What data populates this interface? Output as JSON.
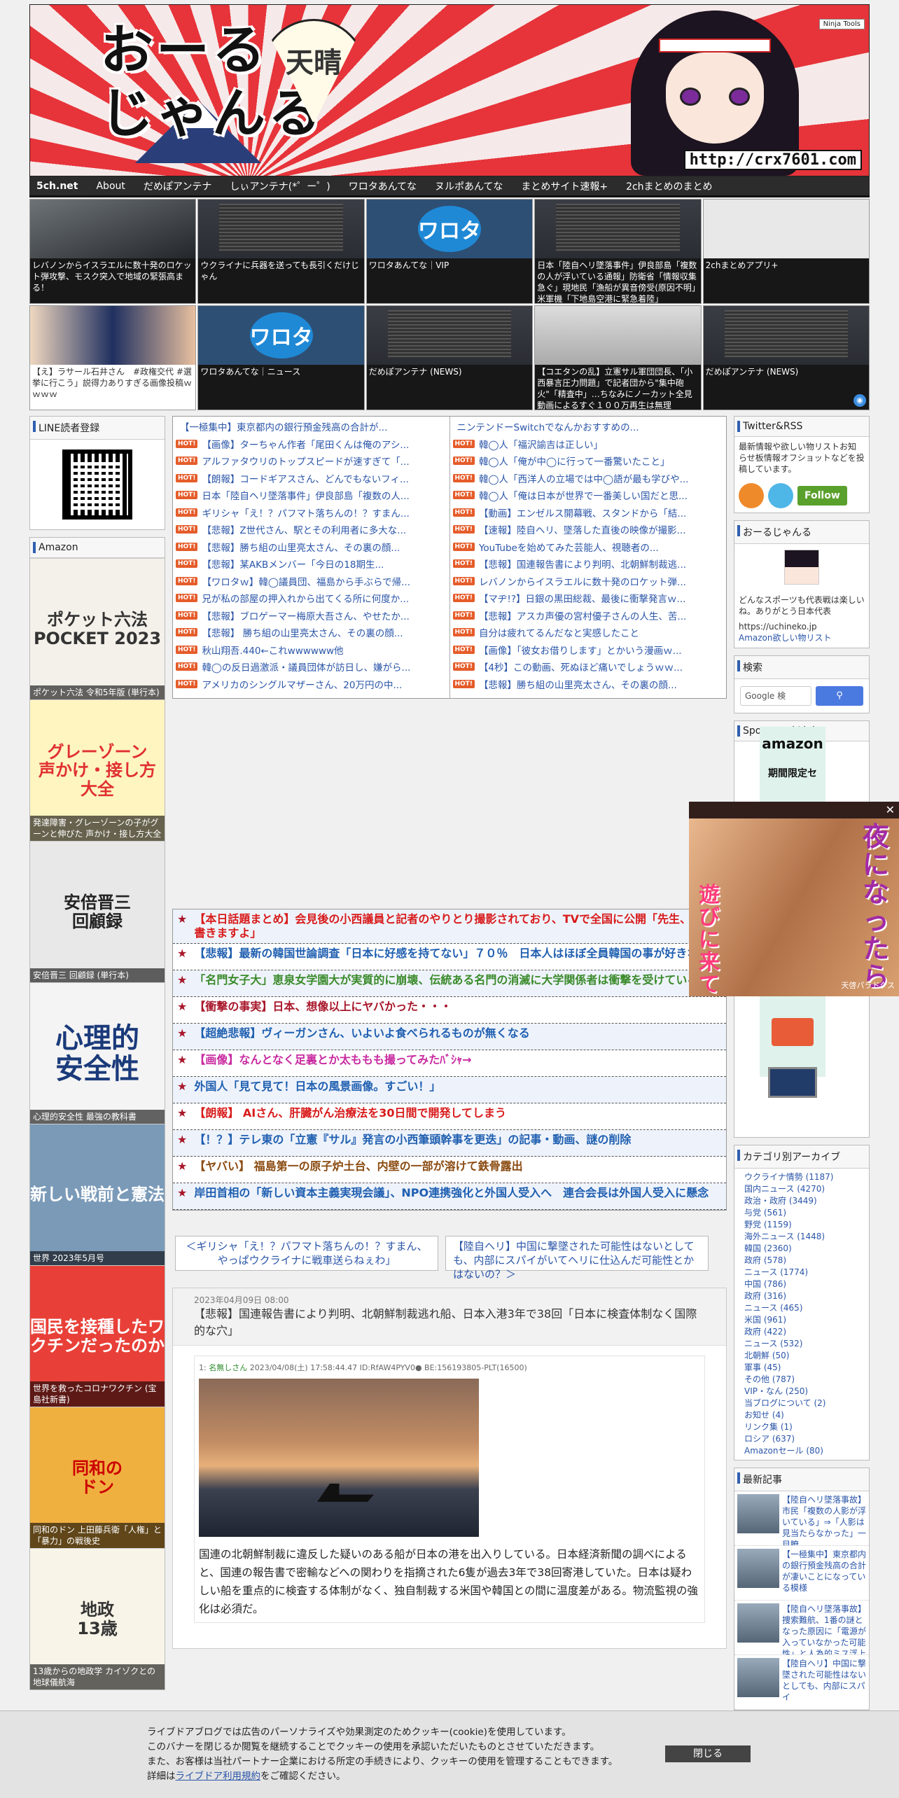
{
  "header": {
    "logo_line1": "おーる",
    "logo_line2": "じゃんる",
    "fan_text": "天晴",
    "url": "http://crx7601.com",
    "ninja_tools": "Ninja Tools"
  },
  "nav": [
    "5ch.net",
    "About",
    "だめぽアンテナ",
    "しぃアンテナ(*゜ー゜)",
    "ワロタあんてな",
    "ヌルポあんてな",
    "まとめサイト速報+",
    "2chまとめのまとめ"
  ],
  "tiles": [
    {
      "caption": "レバノンからイスラエルに数十発のロケット弾攻撃、モスク突入で地域の緊張高まる！",
      "img": "smoke",
      "dark": true
    },
    {
      "caption": "ウクライナに兵器を送っても長引くだけじゃん",
      "img": "screen",
      "dark": true
    },
    {
      "caption": "ワロタあんてな｜VIP",
      "img": "wota",
      "dark": true
    },
    {
      "caption": "日本「陸自ヘリ墜落事件」伊良部島「複数の人が浮いている通報」防衛省「情報収集急ぐ」現地民「漁船が異音傍受(原因不明」米軍機「下地島空港に緊急着陸」",
      "img": "screen",
      "dark": true
    },
    {
      "caption": "2chまとめアプリ+",
      "img": "paper",
      "dark": true
    },
    {
      "caption": "【え】ラサール石井さん　#政権交代 #選挙に行こう」説得力ありすぎる画像投稿ｗｗｗｗ",
      "img": "people",
      "dark": false
    },
    {
      "caption": "ワロタあんてな｜ニュース",
      "img": "wota",
      "dark": true
    },
    {
      "caption": "だめぽアンテナ (NEWS)",
      "img": "screen",
      "dark": true
    },
    {
      "caption": "【コエタンの乱】立憲サル軍団団長、「小西暴言圧力問題」で記者団から\"集中砲火\"「精査中」…ちなみにノーカット全見動画によるすぐ１００万再生は無理",
      "img": "person",
      "dark": true
    },
    {
      "caption": "だめぽアンテナ (NEWS)",
      "img": "screen",
      "dark": true
    }
  ],
  "wota_logo": "ワロタ",
  "left": {
    "line_title": "LINE読者登録",
    "amazon_title": "Amazon",
    "books": [
      {
        "title": "ポケット六法 令和5年版 (単行本)",
        "cover": "ポケット六法\nPOCKET 2023",
        "bg": "#f4f1ea",
        "fg": "#333"
      },
      {
        "title": "発達障害・グレーゾーンの子がグーンと伸びた 声かけ・接し方大全",
        "cover": "グレーゾーン\n声かけ・接し方\n大全",
        "bg": "#fff5c0",
        "fg": "#e03030"
      },
      {
        "title": "安倍晋三 回顧録 (単行本)",
        "cover": "安倍晋三\n回顧録",
        "bg": "#e8e8e8",
        "fg": "#222"
      },
      {
        "title": "心理的安全性 最強の教科書",
        "cover": "心理的\n安全性",
        "bg": "#f4f4f4",
        "fg": "#1a3a7a"
      },
      {
        "title": "世界 2023年5月号",
        "cover": "新しい戦前と憲法",
        "bg": "#7a9ab8",
        "fg": "#fff"
      },
      {
        "title": "世界を救ったコロナワクチン (宝島社新書)",
        "cover": "国民を接種したワクチンだったのか",
        "bg": "#e84038",
        "fg": "#fff"
      },
      {
        "title": "同和のドン 上田藤兵衛「人権」と「暴力」の戦後史",
        "cover": "同和の\nドン",
        "bg": "#f0b040",
        "fg": "#c00"
      },
      {
        "title": "13歳からの地政学 カイゾクとの地球儀航海",
        "cover": "地政\n13歳",
        "bg": "#f8f4e8",
        "fg": "#333"
      }
    ]
  },
  "rank_left": [
    {
      "t": "【一極集中】東京都内の銀行預金残高の合計が...",
      "hot": false
    },
    {
      "t": "【画像】ターちゃん作者「尾田くんは俺のアシ...",
      "hot": true
    },
    {
      "t": "アルファタウリのトップスピードが速すぎて「...",
      "hot": true
    },
    {
      "t": "【朗報】コードギアスさん、どんでもないフィ...",
      "hot": true
    },
    {
      "t": "日本「陸自ヘリ墜落事件」伊良部島「複数の人...",
      "hot": true
    },
    {
      "t": "ギリシャ「え！？パフマト落ちんの！？すまん...",
      "hot": true
    },
    {
      "t": "【悲報】Z世代さん、駅とその利用者に多大な...",
      "hot": true
    },
    {
      "t": "【悲報】勝ち組の山里亮太さん、その裏の顔...",
      "hot": true
    },
    {
      "t": "【悲報】某AKBメンバー「今日の18期生...",
      "hot": true
    },
    {
      "t": "【ワロタｗ】韓◯議員団、福島から手ぶらで帰...",
      "hot": true
    },
    {
      "t": "兄が私の部屋の押入れから出てくる所に何度か...",
      "hot": true
    },
    {
      "t": "【悲報】ブロゲーマー梅原大吾さん、やせたか...",
      "hot": true
    },
    {
      "t": "【悲報】 勝ち組の山里亮太さん、その裏の顔...",
      "hot": true
    },
    {
      "t": "秋山翔吾.440←これwwwwww他",
      "hot": true
    },
    {
      "t": "韓◯の反日過激派・議員団体が訪日し、嫌がら...",
      "hot": true
    },
    {
      "t": "アメリカのシングルマザーさん、20万円の中...",
      "hot": true
    }
  ],
  "rank_right": [
    {
      "t": "ニンテンドーSwitchでなんかおすすめの...",
      "hot": false
    },
    {
      "t": "韓◯人「福沢諭吉は正しい」",
      "hot": true
    },
    {
      "t": "韓◯人「俺が中◯に行って一番驚いたこと」",
      "hot": true
    },
    {
      "t": "韓◯人「西洋人の立場では中◯語が最も学びや...",
      "hot": true
    },
    {
      "t": "韓◯人「俺は日本が世界で一番美しい国だと思...",
      "hot": true
    },
    {
      "t": "【動画】エンゼルス開幕戦、スタンドから「結...",
      "hot": true
    },
    {
      "t": "【速報】陸自ヘリ、墜落した直後の映像が撮影...",
      "hot": true
    },
    {
      "t": "YouTubeを始めてみた芸能人、視聴者の...",
      "hot": true
    },
    {
      "t": "【悲報】国連報告書により判明、北朝鮮制裁逃...",
      "hot": true
    },
    {
      "t": "レバノンからイスラエルに数十発のロケット弾...",
      "hot": true
    },
    {
      "t": "【マヂ!?】日銀の黒田総裁、最後に衝撃発言ｗ...",
      "hot": true
    },
    {
      "t": "【悲報】アスカ声優の宮村優子さんの人生、苦...",
      "hot": true
    },
    {
      "t": "自分は疲れてるんだなと実感したこと",
      "hot": true
    },
    {
      "t": "【画像】「彼女お借りします」とかいう漫画ｗ...",
      "hot": true
    },
    {
      "t": "【4秒】この動画、死ぬほど痛いでしょうｗｗ...",
      "hot": true
    },
    {
      "t": "【悲報】勝ち組の山里亮太さん、その裏の顔...",
      "hot": true
    }
  ],
  "topics": [
    {
      "t": "【本日話題まとめ】会見後の小西議員と記者のやりとり撮影されており、TVで全国に公開「先生、これ書きますよ」",
      "c": "#d81b1b"
    },
    {
      "t": "【悲報】最新の韓国世論調査「日本に好感を持てない」７０％　日本人はほぼ全員韓国の事が好きなのに",
      "c": "#1f5fb0"
    },
    {
      "t": "「名門女子大」恵泉女学園大が実質的に崩壊、伝統ある名門の消滅に大学関係者は衝撃を受けている",
      "c": "#3a8a2a"
    },
    {
      "t": "【衝撃の事実】日本、想像以上にヤバかった・・・",
      "c": "#a8172a"
    },
    {
      "t": "【超絶悲報】ヴィーガンさん、いよいよ食べられるものが無くなる",
      "c": "#1f5fb0"
    },
    {
      "t": "【画像】なんとなく足裏とか太ももも撮ってみたﾊﾞｼｬ→",
      "c": "#c82aa0"
    },
    {
      "t": "外国人「見て見て！日本の風景画像。すごい！」",
      "c": "#1f5fb0"
    },
    {
      "t": "【朗報】 AIさん、肝臓がん治療法を30日間で開発してしまう",
      "c": "#d81b1b"
    },
    {
      "t": "【！？】テレ東の「立憲『サル』発言の小西筆頭幹事を更迭」の記事・動画、謎の削除",
      "c": "#1f5fb0"
    },
    {
      "t": "【ヤバい】 福島第一の原子炉土台、内壁の一部が溶けて鉄骨露出",
      "c": "#8a4a10"
    },
    {
      "t": "岸田首相の「新しい資本主義実現会議」、NPO連携強化と外国人受入へ　連合会長は外国人受入に懸念",
      "c": "#1f5fb0"
    }
  ],
  "pager": {
    "prev": "＜ギリシャ「え！？パフマト落ちんの！？すまん、やっぱウクライナに戦車送らねぇわ」",
    "next": "【陸自ヘリ】中国に撃墜された可能性はないとしても、内部にスパイがいてヘリに仕込んだ可能性とかはないの？＞"
  },
  "article": {
    "date": "2023年04月09日 08:00",
    "title": "【悲報】国連報告書により判明、北朝鮮制裁逃れ船、日本入港3年で38回「日本に検査体制なく国際的な穴」",
    "post_no": "1:",
    "post_name": "名無しさん",
    "post_meta": "2023/04/08(土) 17:58:44.47 ID:RfAW4PYV0● BE:156193805-PLT(16500)",
    "body": "国連の北朝鮮制裁に違反した疑いのある船が日本の港を出入りしている。日本経済新聞の調べによると、国連の報告書で密輸などへの関わりを指摘された6隻が過去3年で38回寄港していた。日本は疑わしい船を重点的に検査する体制がなく、独自制裁する米国や韓国との間に温度差がある。物流監視の強化は必須だ。"
  },
  "right": {
    "twitter_title": "Twitter&RSS",
    "twitter_text": "最新情報や欲しい物リストお知らせ板情報オフショットなどを投稿しています。",
    "follow": "Follow",
    "blog_title": "おーるじゃんる",
    "blog_text": "どんなスポーツも代表戦は楽しいね。ありがとう日本代表",
    "blog_url": "https://uchineko.jp",
    "wishlist": "Amazon欲しい物リスト",
    "search_title": "検索",
    "search_placeholder": "Google 検",
    "sponsored": "Sponsored Links",
    "amazon_logo": "amazon",
    "amazon_sub": "期間限定セ",
    "category_title": "カテゴリ別アーカイブ",
    "categories": [
      "ウクライナ情勢 (1187)",
      "国内ニュース (4270)",
      "政治・政府 (3449)",
      "与党 (561)",
      "野党 (1159)",
      "海外ニュース (1448)",
      "韓国 (2360)",
      "政府 (578)",
      "ニュース (1774)",
      "中国 (786)",
      "政府 (316)",
      "ニュース (465)",
      "米国 (961)",
      "政府 (422)",
      "ニュース (532)",
      "北朝鮮 (50)",
      "軍事 (45)",
      "その他 (787)",
      "VIP・なん (250)",
      "当ブログについて (2)",
      "お知せ (4)",
      "リンク集 (1)",
      "ロシア (637)",
      "Amazonセール (80)"
    ],
    "recent_title": "最新記事",
    "recent": [
      "【陸自ヘリ墜落事故】市民「複数の人影が浮いている」⇒「人影は見当たらなかった」一目瞭",
      "【一極集中】東京都内の銀行預金残高の合計が凄いことになっている模様",
      "【陸自ヘリ墜落事故】捜索難航、1番の謎となった原因に「電源が入っていなかった可能性」と人為的ミス浮上も・・・",
      "【陸自ヘリ】中国に撃墜された可能性はないとしても、内部にスパイ"
    ]
  },
  "overlay": {
    "jp1": "夜になったら",
    "jp2": "遊びに来て",
    "brand": "天啓パラドクス"
  },
  "cookie": {
    "line1": "ライブドアブログでは広告のパーソナライズや効果測定のためクッキー(cookie)を使用しています。",
    "line2": "このバナーを閉じるか閲覧を継続することでクッキーの使用を承認いただいたものとさせていただきます。",
    "line3": "また、お客様は当社パートナー企業における所定の手続きにより、クッキーの使用を管理することもできます。",
    "line4_pre": "詳細は",
    "line4_link": "ライブドア利用規約",
    "line4_post": "をご確認ください。",
    "close": "閉じる"
  }
}
